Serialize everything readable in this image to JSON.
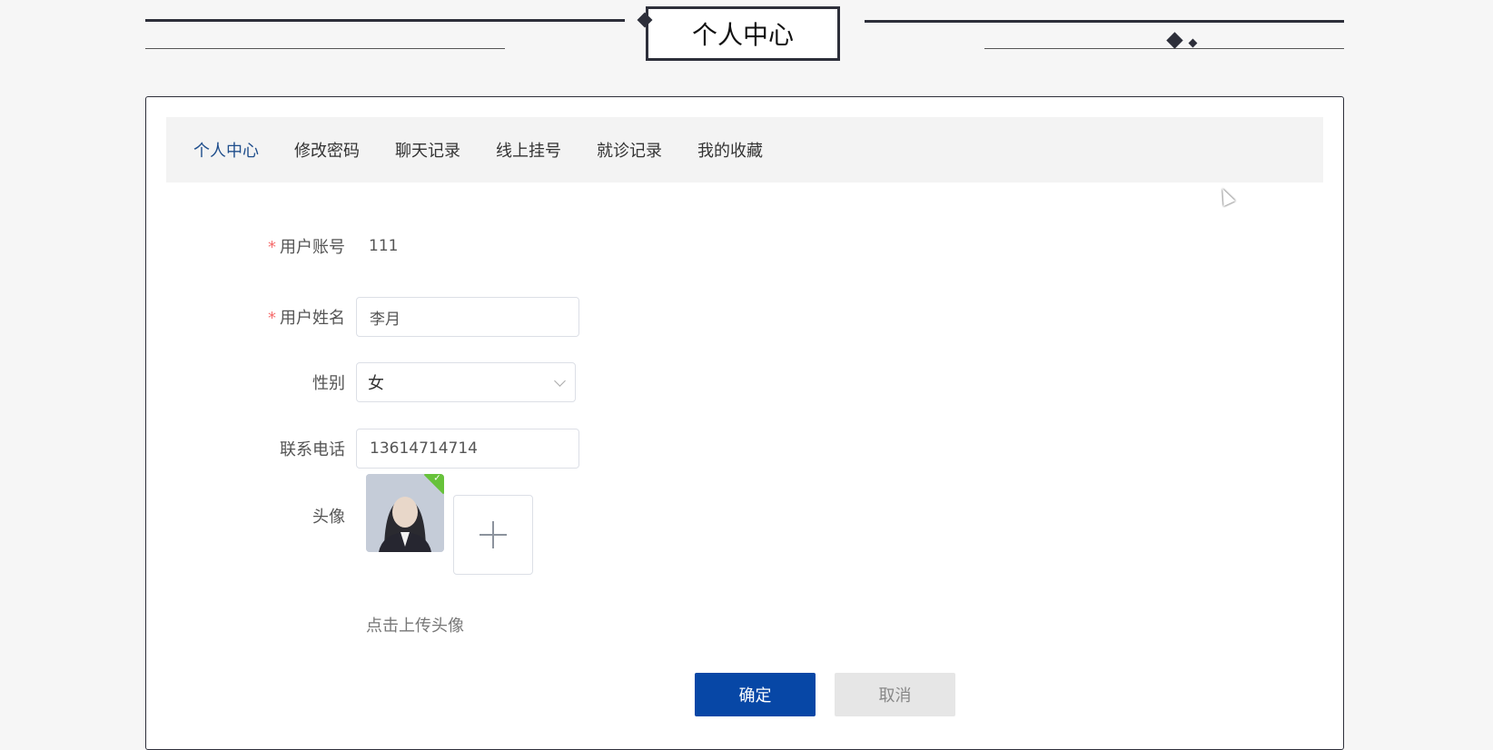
{
  "header": {
    "title": "个人中心"
  },
  "tabs": [
    {
      "label": "个人中心",
      "active": true
    },
    {
      "label": "修改密码",
      "active": false
    },
    {
      "label": "聊天记录",
      "active": false
    },
    {
      "label": "线上挂号",
      "active": false
    },
    {
      "label": "就诊记录",
      "active": false
    },
    {
      "label": "我的收藏",
      "active": false
    }
  ],
  "form": {
    "account": {
      "label": "用户账号",
      "required": true,
      "value": "111"
    },
    "name": {
      "label": "用户姓名",
      "required": true,
      "value": "李月"
    },
    "gender": {
      "label": "性别",
      "value": "女"
    },
    "phone": {
      "label": "联系电话",
      "value": "13614714714"
    },
    "avatar": {
      "label": "头像",
      "hint": "点击上传头像",
      "uploaded_icon": "check-icon"
    }
  },
  "buttons": {
    "confirm": "确定",
    "cancel": "取消"
  },
  "colors": {
    "accent": "#0747a6",
    "active_tab": "#1f4e8c",
    "required": "#f56c6c",
    "dark_line": "#2d2f3a"
  },
  "icons": {
    "required_mark": "*",
    "upload": "plus-icon",
    "select": "chevron-down-icon"
  }
}
